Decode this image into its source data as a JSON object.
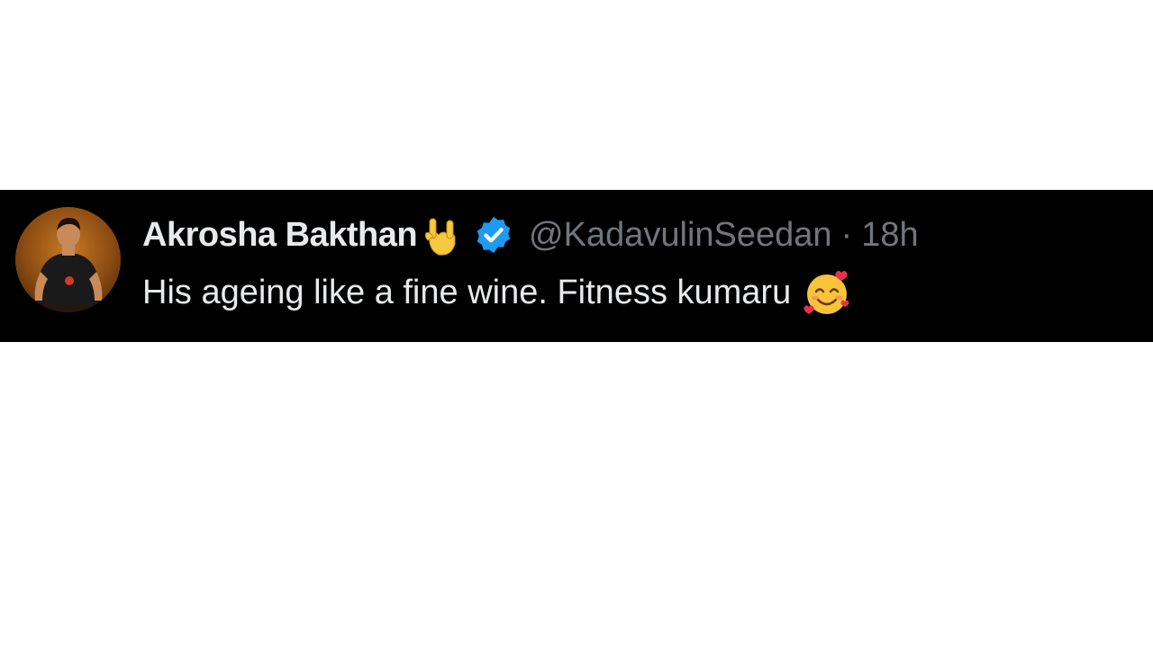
{
  "tweet": {
    "display_name": "Akrosha Bakthan",
    "name_emoji": "rock-on-hand-icon",
    "verified": true,
    "verified_badge": "verified-badge-icon",
    "handle": "@KadavulinSeedan",
    "separator": "·",
    "timestamp": "18h",
    "text": "His ageing like a fine wine. Fitness kumaru",
    "text_emoji": "smiling-face-with-hearts-icon",
    "avatar": "avatar-illustration"
  },
  "colors": {
    "background": "#000000",
    "primary_text": "#e7e9ea",
    "secondary_text": "#71767b",
    "verified_blue": "#1d9bf0",
    "page_background": "#ffffff"
  }
}
